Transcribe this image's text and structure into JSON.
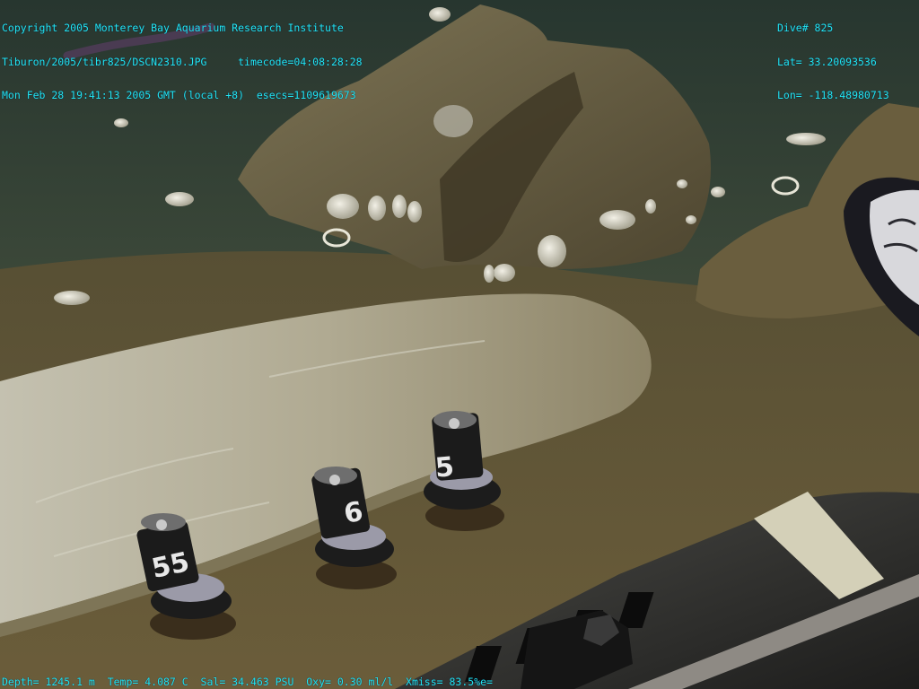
{
  "overlay": {
    "top_left": [
      "Copyright 2005 Monterey Bay Aquarium Research Institute",
      "Tiburon/2005/tibr825/DSCN2310.JPG     timecode=04:08:28:28",
      "Mon Feb 28 19:41:13 2005 GMT (local +8)  esecs=1109619673"
    ],
    "top_right": [
      "Dive# 825",
      "Lat= 33.20093536",
      "Lon= -118.48980713"
    ],
    "bottom": "Depth= 1245.1 m  Temp= 4.087 C  Sal= 34.463 PSU  Oxy= 0.30 ml/l  Xmiss= 83.5%e="
  },
  "markers": [
    "55",
    "6",
    "5"
  ],
  "colors": {
    "overlay_text": "#22e8f0",
    "sediment": "#5e5638",
    "whale_bone": "#b8b3a0",
    "rock": "#6e6445",
    "water": "#2d3d33"
  }
}
